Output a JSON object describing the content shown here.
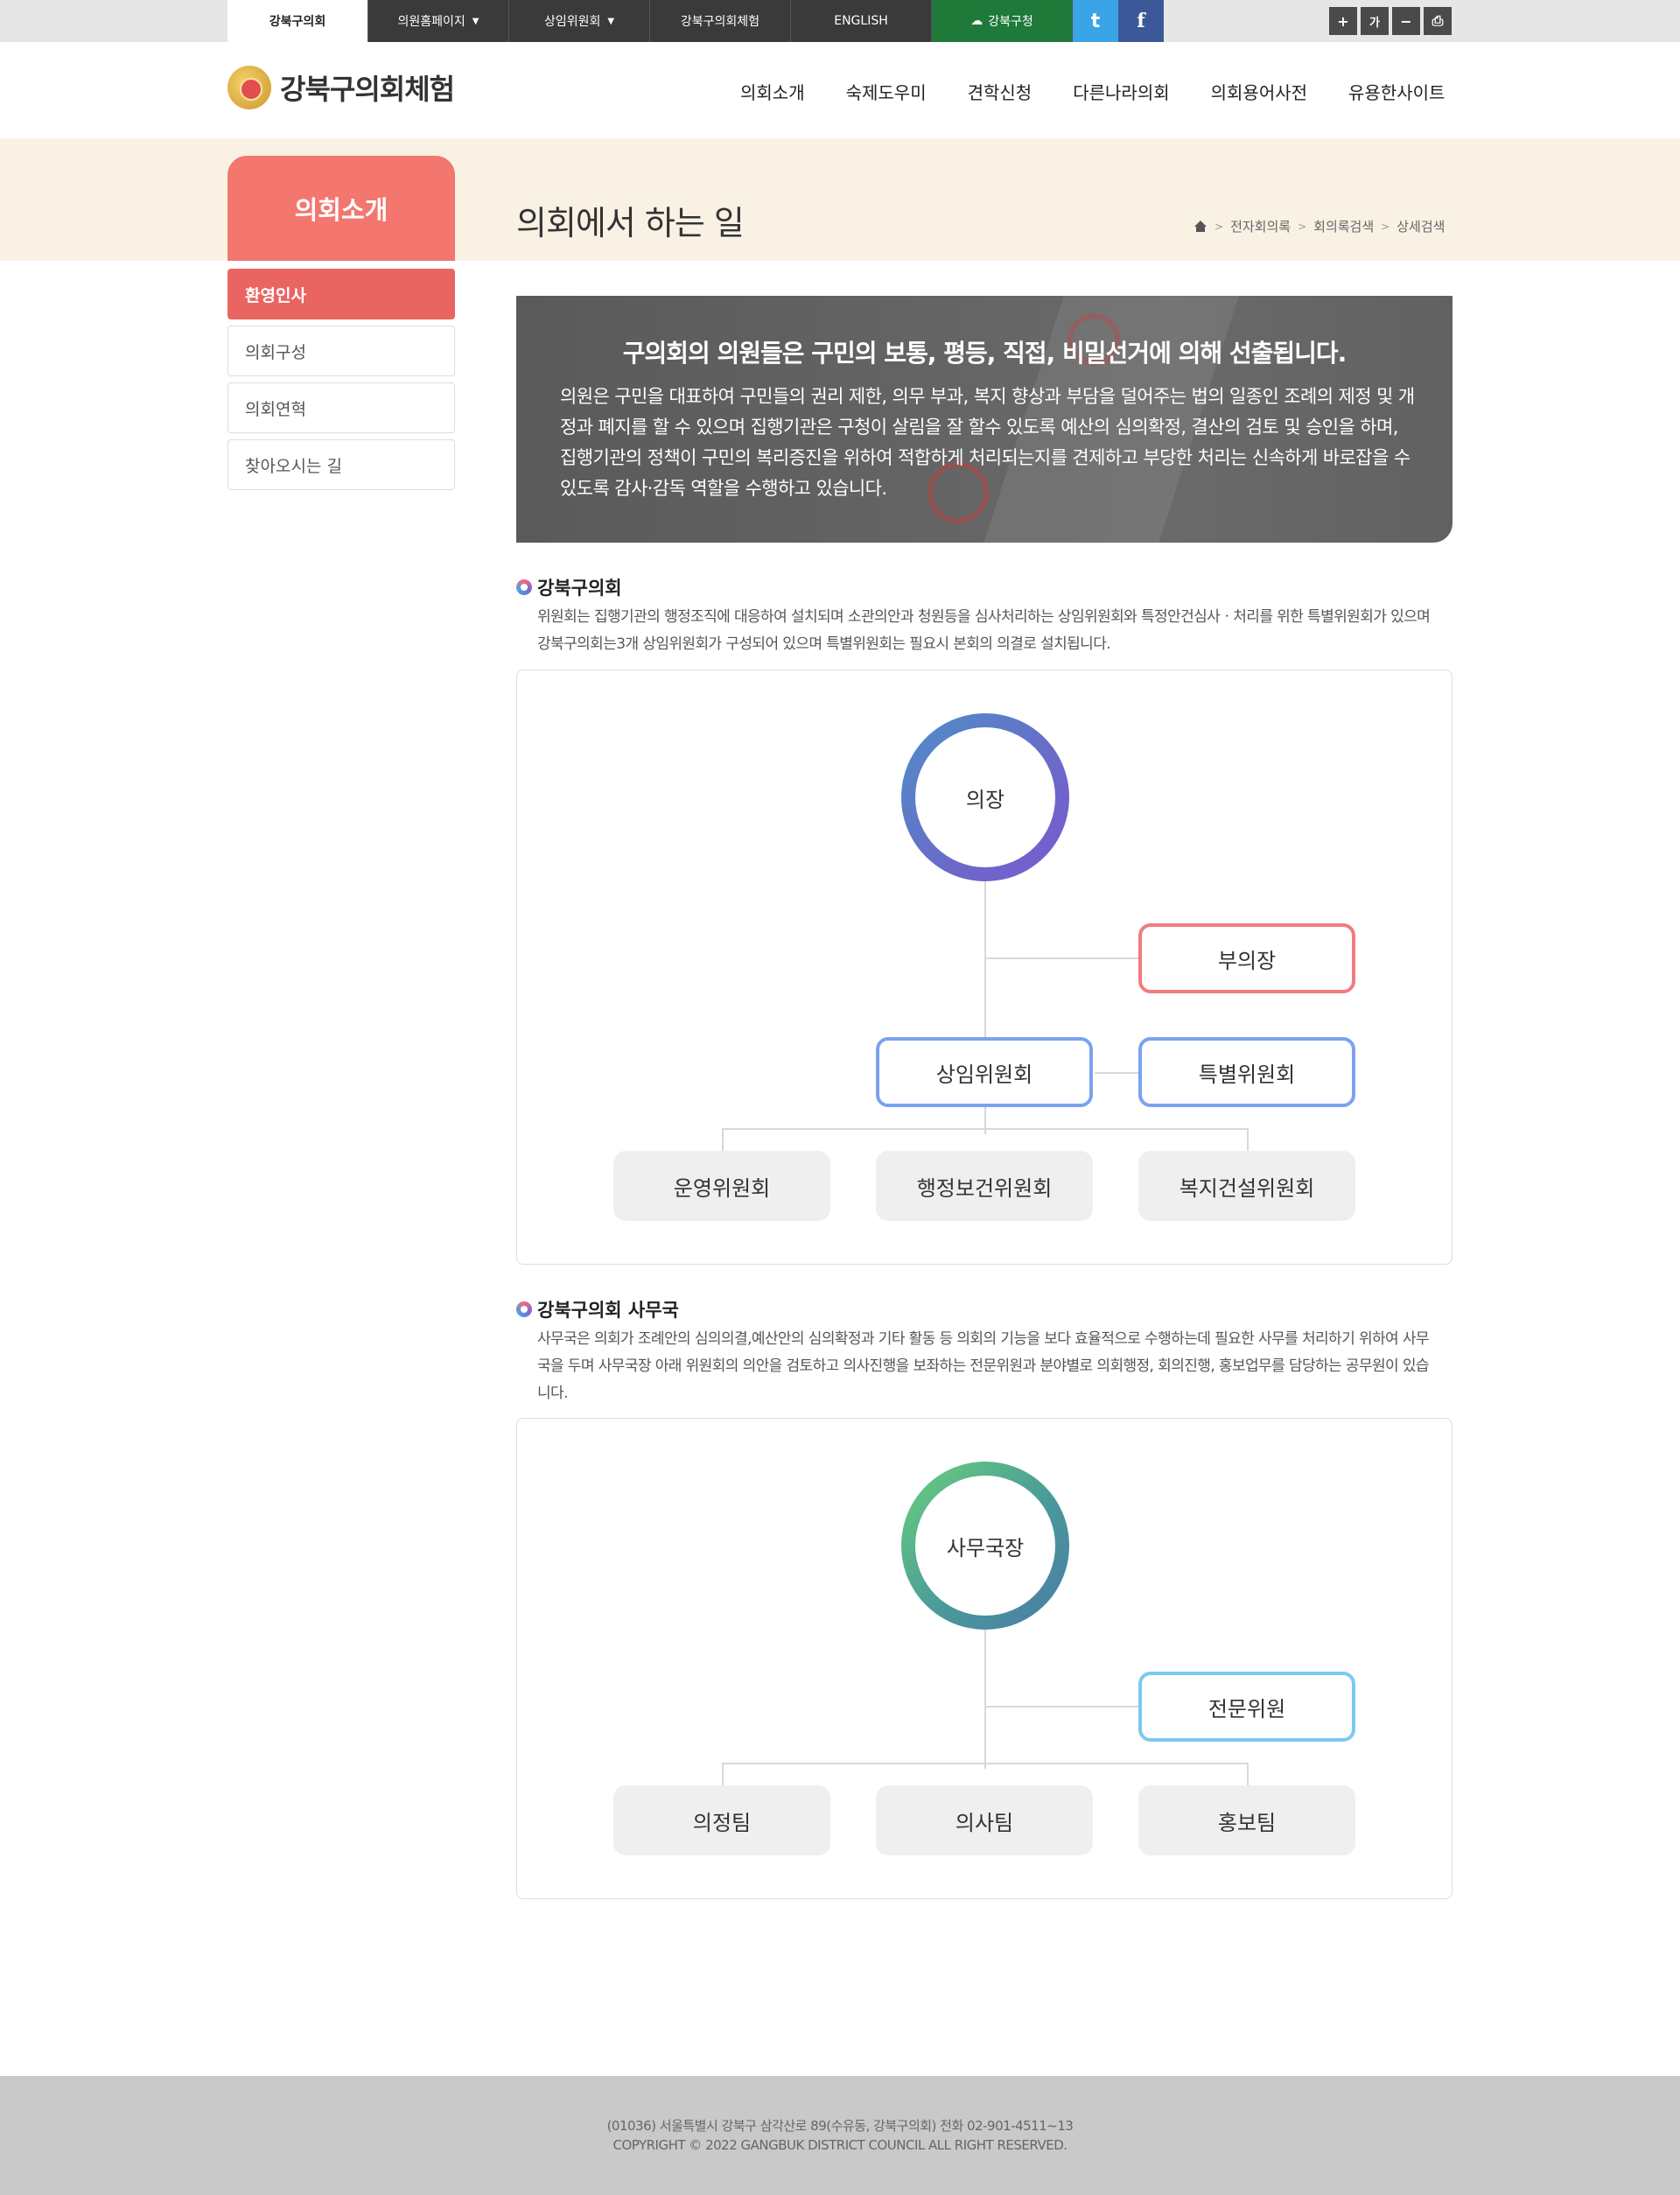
{
  "topbar": {
    "tabs": [
      {
        "label": "강북구의회",
        "active": true
      },
      {
        "label": "의원홈페이지",
        "dropdown": true
      },
      {
        "label": "상임위원회",
        "dropdown": true
      },
      {
        "label": "강북구의회체험"
      },
      {
        "label": "ENGLISH"
      },
      {
        "label": "강북구청",
        "color": "#1f7a3a"
      }
    ],
    "sns": {
      "twitter": "t",
      "facebook": "f"
    },
    "tools": {
      "zoom_in": "+",
      "font": "가",
      "zoom_out": "−",
      "print": "⎙"
    }
  },
  "header": {
    "logo_text": "강북구의회체험",
    "nav": [
      "의회소개",
      "숙제도우미",
      "견학신청",
      "다른나라의회",
      "의회용어사전",
      "유용한사이트"
    ]
  },
  "sub": {
    "section_title": "의회소개",
    "page_title": "의회에서 하는 일",
    "breadcrumb": [
      "전자회의록",
      "회의록검색",
      "상세검색"
    ]
  },
  "sidemenu": [
    {
      "label": "환영인사",
      "active": true
    },
    {
      "label": "의회구성"
    },
    {
      "label": "의회연혁"
    },
    {
      "label": "찾아오시는 길"
    }
  ],
  "intro": {
    "heading": "구의회의 의원들은 구민의 보통, 평등, 직접, 비밀선거에 의해 선출됩니다.",
    "body": "의원은 구민을 대표하여 구민들의 권리 제한, 의무 부과, 복지 향상과 부담을 덜어주는 법의 일종인 조례의 제정 및 개정과 폐지를 할 수 있으며 집행기관은 구청이 살림을 잘 할수 있도록 예산의 심의확정, 결산의 검토 및 승인을 하며, 집행기관의 정책이 구민의 복리증진을 위하여 적합하게 처리되는지를 견제하고 부당한 처리는 신속하게 바로잡을 수 있도록 감사·감독 역할을 수행하고 있습니다."
  },
  "council": {
    "title": "강북구의회",
    "desc": "위원회는 집행기관의 행정조직에 대응하여 설치되며 소관의안과 청원등을 심사처리하는 상임위원회와 특정안건심사ㆍ처리를 위한 특별위원회가 있으며 강북구의회는3개 상임위원회가 구성되어 있으며 특별위원회는 필요시 본회의 의결로 설치됩니다.",
    "chair": "의장",
    "vice_chair": "부의장",
    "standing": "상임위원회",
    "special": "특별위원회",
    "committees": [
      "운영위원회",
      "행정보건위원회",
      "복지건설위원회"
    ]
  },
  "secretariat": {
    "title": "강북구의회 사무국",
    "desc": "사무국은 의회가 조례안의 심의의결,예산안의 심의확정과 기타 활동 등 의회의 기능을 보다 효율적으로 수행하는데 필요한 사무를 처리하기 위하여 사무국을 두며 사무국장 아래 위원회의 의안을 검토하고 의사진행을 보좌하는 전문위원과 분야별로 의회행정, 회의진행, 홍보업무를 담당하는 공무원이 있습니다.",
    "head": "사무국장",
    "expert": "전문위원",
    "teams": [
      "의정팀",
      "의사팀",
      "홍보팀"
    ]
  },
  "footer": {
    "address": "(01036) 서울특별시 강북구 삼각산로 89(수유동, 강북구의회) 전화 02-901-4511~13",
    "copyright": "COPYRIGHT © 2022 GANGBUK DISTRICT COUNCIL ALL RIGHT RESERVED."
  }
}
